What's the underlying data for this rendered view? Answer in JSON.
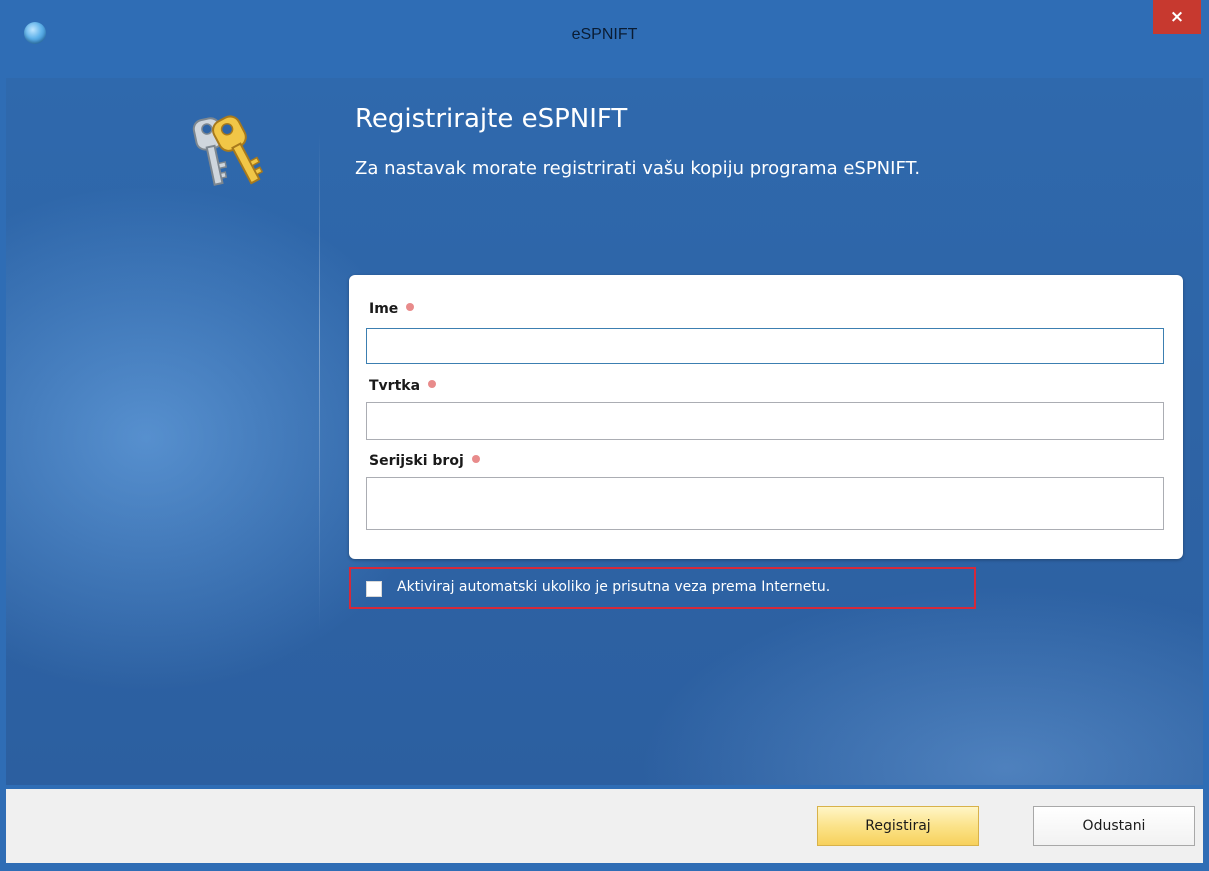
{
  "window": {
    "title": "eSPNIFT",
    "close_label": "×",
    "accent_color": "#2f6db5",
    "close_color": "#c7392f"
  },
  "header": {
    "heading": "Registrirajte eSPNIFT",
    "subheading": "Za nastavak morate registrirati vašu kopiju programa eSPNIFT."
  },
  "form": {
    "fields": [
      {
        "label": "Ime",
        "value": "",
        "required": true,
        "focused": true
      },
      {
        "label": "Tvrtka",
        "value": "",
        "required": true,
        "focused": false
      },
      {
        "label": "Serijski broj",
        "value": "",
        "required": true,
        "focused": false
      }
    ],
    "required_color": "#e88b8b"
  },
  "auto_activate": {
    "label": "Aktiviraj automatski ukoliko je prisutna veza prema Internetu.",
    "checked": false,
    "highlight_color": "#d6293a"
  },
  "buttons": {
    "primary_label": "Registiraj",
    "secondary_label": "Odustani"
  },
  "icons": {
    "app": "app-globe-icon",
    "keys": "keys-icon",
    "close": "close-icon"
  }
}
